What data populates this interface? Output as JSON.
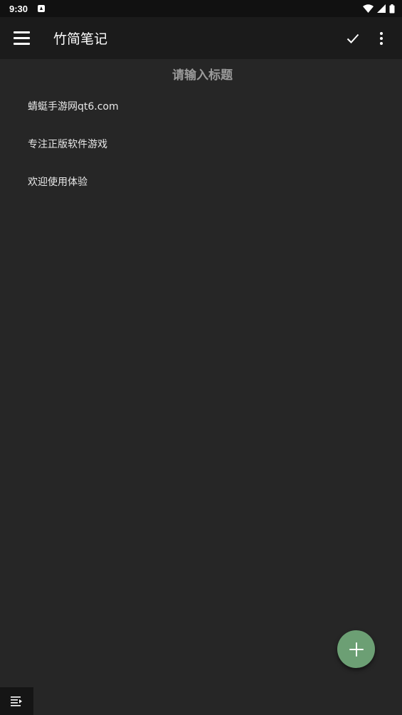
{
  "status_bar": {
    "time": "9:30"
  },
  "app_bar": {
    "title": "竹简笔记"
  },
  "editor": {
    "title_placeholder": "请输入标题",
    "lines": [
      "蜻蜓手游网qt6.com",
      "专注正版软件游戏",
      "欢迎使用体验"
    ]
  },
  "colors": {
    "background": "#262626",
    "app_bar": "#1b1b1b",
    "status_bar": "#111111",
    "fab": "#6c9f74"
  },
  "icons": {
    "menu": "menu-icon",
    "check": "check-icon",
    "more": "more-vert-icon",
    "add": "plus-icon",
    "format": "format-list-icon",
    "wifi": "wifi-icon",
    "signal": "signal-icon",
    "battery": "battery-icon",
    "notification": "notification-a-icon"
  }
}
